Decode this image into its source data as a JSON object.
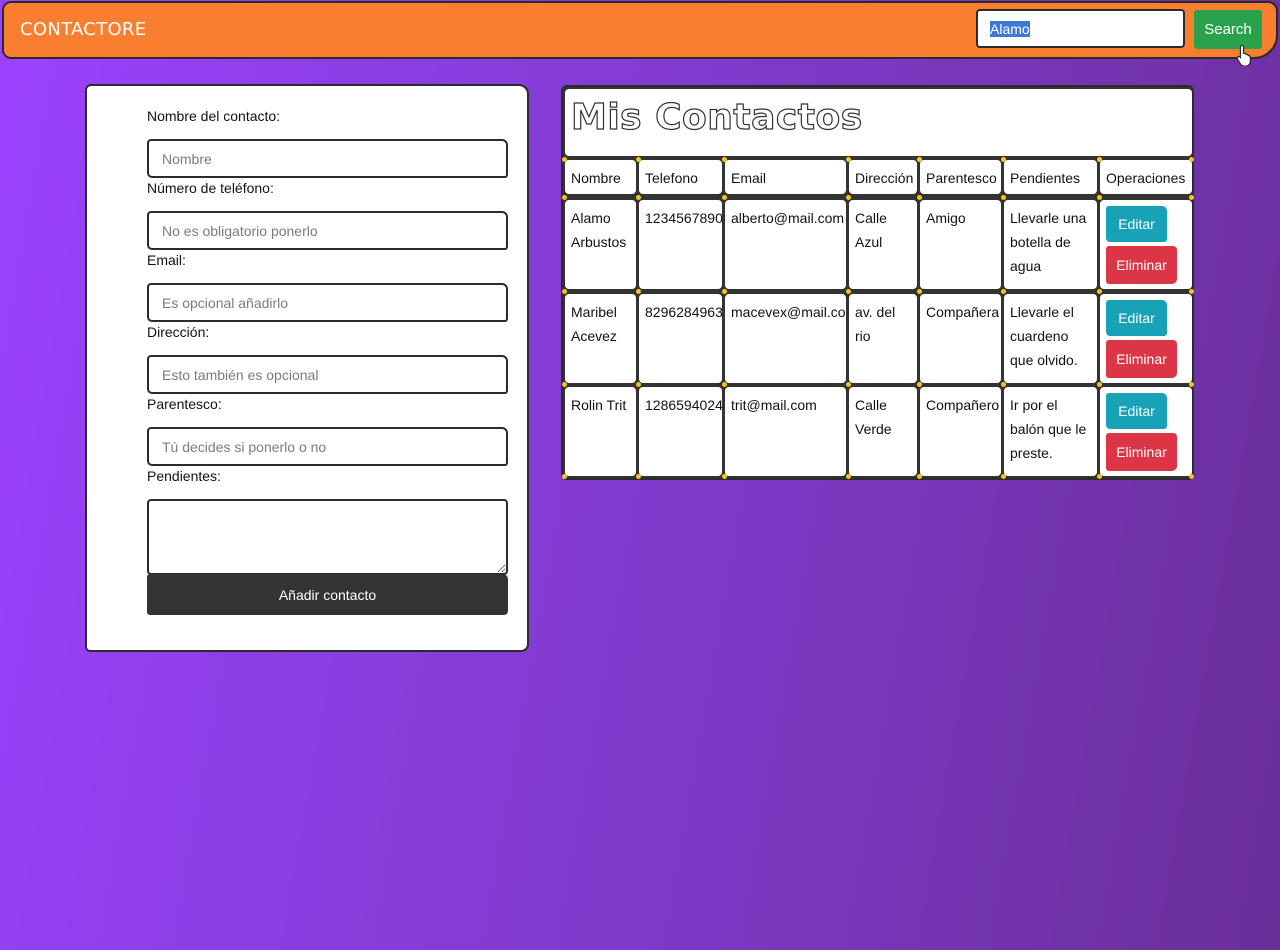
{
  "navbar": {
    "brand": "CONTACTORE",
    "search_value": "Alamo",
    "search_button": "Search"
  },
  "form": {
    "fields": [
      {
        "label": "Nombre del contacto:",
        "placeholder": "Nombre"
      },
      {
        "label": "Número de teléfono:",
        "placeholder": "No es obligatorio ponerlo"
      },
      {
        "label": "Email:",
        "placeholder": "Es opcional añadirlo"
      },
      {
        "label": "Dirección:",
        "placeholder": "Esto también es opcional"
      },
      {
        "label": "Parentesco:",
        "placeholder": "Tú decides si ponerlo o no"
      }
    ],
    "pendientes_label": "Pendientes:",
    "submit_label": "Añadir contacto"
  },
  "contacts": {
    "title": "Mis Contactos",
    "headers": [
      "Nombre",
      "Telefono",
      "Email",
      "Dirección",
      "Parentesco",
      "Pendientes",
      "Operaciones"
    ],
    "rows": [
      {
        "nombre": "Alamo Arbustos",
        "telefono": "1234567890",
        "email": "alberto@mail.com",
        "direccion": "Calle Azul",
        "parentesco": "Amigo",
        "pendientes": "Llevarle una botella de agua"
      },
      {
        "nombre": "Maribel Acevez",
        "telefono": "8296284963",
        "email": "macevex@mail.com",
        "direccion": "av. del rio",
        "parentesco": "Compañera",
        "pendientes": "Llevarle el cuardeno que olvido."
      },
      {
        "nombre": "Rolin Trit",
        "telefono": "1286594024",
        "email": "trit@mail.com",
        "direccion": "Calle Verde",
        "parentesco": "Compañero",
        "pendientes": "Ir por el balón que le preste."
      }
    ],
    "edit_label": "Editar",
    "delete_label": "Eliminar"
  },
  "colors": {
    "navbar": "#f87e30",
    "search_button": "#2aa24b",
    "edit_button": "#17a2b8",
    "delete_button": "#dc3545",
    "submit_button": "#333333",
    "background_start": "#9b42ff",
    "background_end": "#6a2e98"
  }
}
